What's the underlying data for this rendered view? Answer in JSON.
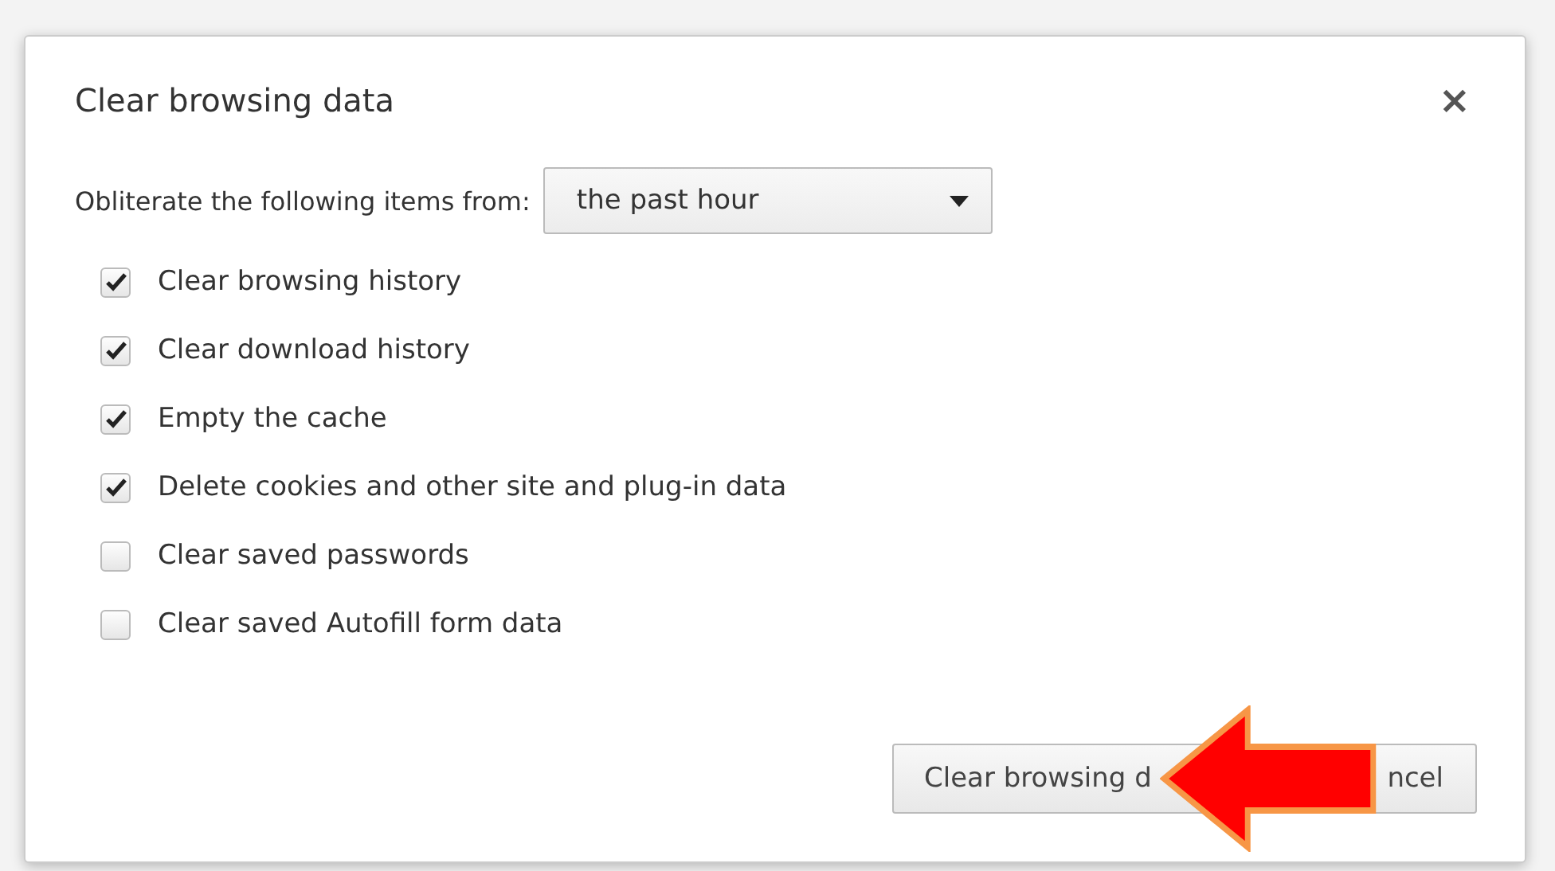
{
  "dialog": {
    "title": "Clear browsing data",
    "close": "×"
  },
  "range": {
    "label": "Obliterate the following items from:",
    "value": "the past hour"
  },
  "options": [
    {
      "label": "Clear browsing history",
      "checked": true
    },
    {
      "label": "Clear download history",
      "checked": true
    },
    {
      "label": "Empty the cache",
      "checked": true
    },
    {
      "label": "Delete cookies and other site and plug-in data",
      "checked": true
    },
    {
      "label": "Clear saved passwords",
      "checked": false
    },
    {
      "label": "Clear saved Autofill form data",
      "checked": false
    }
  ],
  "buttons": [
    {
      "label": "Clear browsing d"
    },
    {
      "label": "ncel"
    }
  ]
}
